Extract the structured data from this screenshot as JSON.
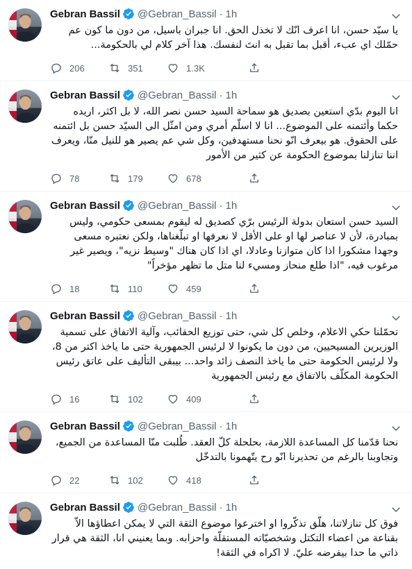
{
  "tweets": [
    {
      "name": "Gebran Bassil",
      "handle": "@Gebran_Bassil",
      "time": "1h",
      "text": "يا سيّد حسن، انا اعرف انّك لا تخذل الحق. انا جبران باسيل، من دون ما كون عم حمّلك اي عبء، أقبل بما تقبل به انتَ لنفسك. هذا آخر كلام لي بالحكومة...",
      "replies": "206",
      "retweets": "351",
      "likes": "1.3K"
    },
    {
      "name": "Gebran Bassil",
      "handle": "@Gebran_Bassil",
      "time": "1h",
      "text": "انا اليوم بدّي استعين بصديق هو سماحة السيد حسن نصر الله، لا بل اكثر، اريده حكما وأئتمنه على الموضوع... انا لا اسلّم أمري ومن امثّل الى السيّد حسن بل ائتمنه على الحقوق. هو بيعرف انّو نحنا مستهدفين، وكل شي عم يصير هو للنيل منّا، ويعرف اننا تنازلنا بموضوع الحكومة عن كثير من الأمور",
      "replies": "78",
      "retweets": "179",
      "likes": "678"
    },
    {
      "name": "Gebran Bassil",
      "handle": "@Gebran_Bassil",
      "time": "1h",
      "text": "السيد حسن استعان بدولة الرئيس برّي كصديق له ليقوم بمسعى حكومي، وليس بمبادرة، لأن لا عناصر لها او على الأقل لا نعرفها او تبلّغناها، ولكن نعتبره مسعى وجهدا مشكورا اذا كان متوازنا وعادلا، اي اذا كان هناك \"وسيط نزيه\"، ويصير غير مرغوب فيه، \"اذا طلع منحاز ومسيء لنا متل ما تظهر مؤخراً\"",
      "replies": "18",
      "retweets": "110",
      "likes": "459"
    },
    {
      "name": "Gebran Bassil",
      "handle": "@Gebran_Bassil",
      "time": "1h",
      "text": "تحمّلنا حكي الاعلام، وخلص كل شي، حتى توزيع الحقائب، وآلية الاتفاق على تسمية الوزيرين المسيحيين، من دون ما يكونوا لا لرئيس الجمهورية حتى ما ياخذ اكتر من 8، ولا لرئيس الحكومة حتى ما ياخذ النصف زائد واحد... بيبقى التأليف على عاتق رئيس الحكومة المكلّف بالاتفاق مع رئيس الجمهورية",
      "replies": "16",
      "retweets": "102",
      "likes": "409"
    },
    {
      "name": "Gebran Bassil",
      "handle": "@Gebran_Bassil",
      "time": "1h",
      "text": "نحنا قدّمنا كل المساعدة اللازمة، بحلحلة كلّ العقد. طُلبت منّا المساعدة من الجميع، وتجاوبنا بالرغم من تحذيرنا انّو رح يتّهمونا بالتدخّل",
      "replies": "22",
      "retweets": "102",
      "likes": "418"
    },
    {
      "name": "Gebran Bassil",
      "handle": "@Gebran_Bassil",
      "time": "1h",
      "text": "فوق كل تنازلاتنا، هلّق تذكّروا او اخترعوا موضوع الثقة التي لا يمكن اعطاؤها الاّ بقناعة من اعضاء التكتل وشخصيّاته المستقلّة واحزابه. وبما يعنيني انا، الثقة هي قرار ذاتي ما حدا بيفرضه عليّ. لا اكراه في الثقة!",
      "replies": "",
      "retweets": "",
      "likes": ""
    }
  ],
  "icons": {
    "verified": "verified-badge-icon",
    "more": "chevron-down-icon",
    "reply": "reply-icon",
    "retweet": "retweet-icon",
    "like": "heart-icon",
    "share": "share-icon"
  },
  "colors": {
    "verified": "#1d9bf0",
    "secondary_text": "#536471",
    "divider": "#eff3f4"
  }
}
